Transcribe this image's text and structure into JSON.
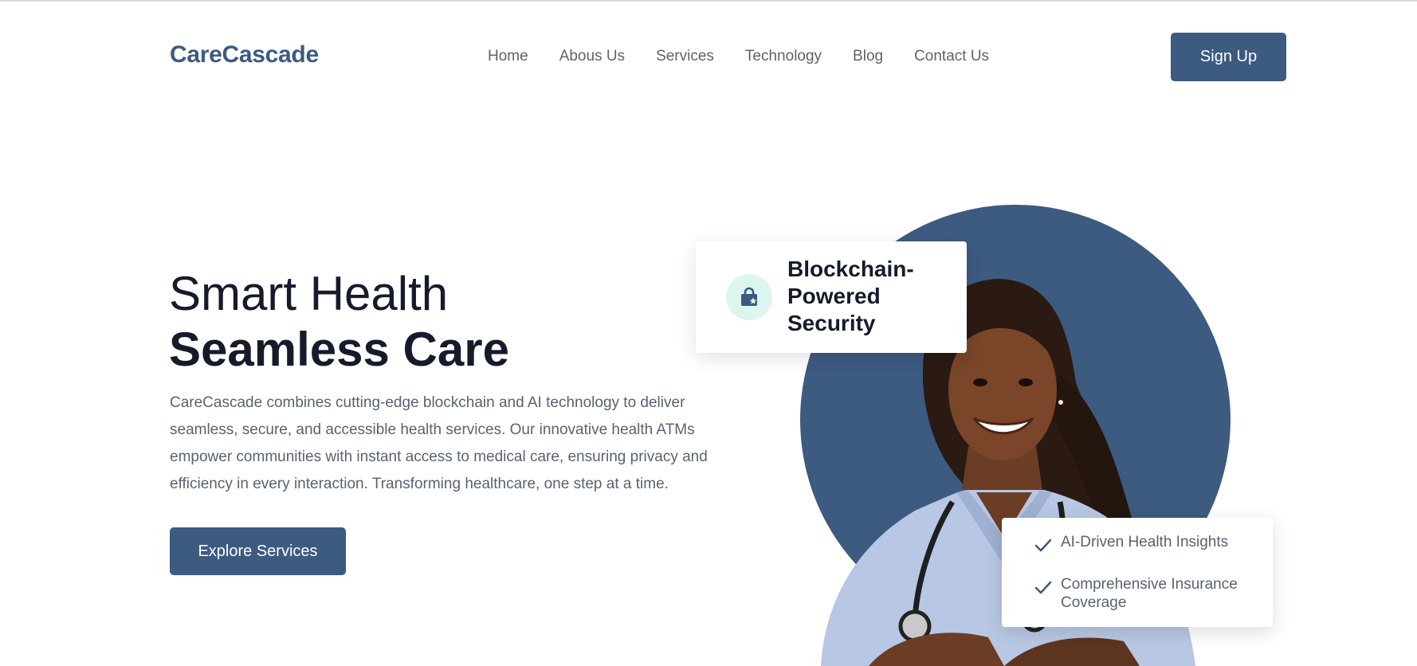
{
  "header": {
    "logo": "CareCascade",
    "nav": [
      "Home",
      "Abous Us",
      "Services",
      "Technology",
      "Blog",
      "Contact Us"
    ],
    "signup_label": "Sign Up"
  },
  "hero": {
    "title_light": "Smart Health",
    "title_bold": "Seamless Care",
    "description": "CareCascade combines cutting-edge blockchain and AI technology to deliver seamless, secure, and accessible health services. Our innovative health ATMs empower communities with instant access to medical care, ensuring privacy and efficiency in every interaction. Transforming healthcare, one step at a time.",
    "cta_label": "Explore Services"
  },
  "security_card": {
    "icon": "lock-star-icon",
    "title": "Blockchain-Powered Security"
  },
  "features_card": {
    "icon": "check-icon",
    "items": [
      "AI-Driven Health Insights",
      "Comprehensive Insurance Coverage"
    ]
  },
  "colors": {
    "primary": "#3d5a80",
    "icon_bg": "#dcf6ef",
    "heading": "#151b2b",
    "body_text": "#5a6270"
  },
  "image": {
    "subject": "smiling healthcare worker in light blue scrubs with stethoscope"
  }
}
